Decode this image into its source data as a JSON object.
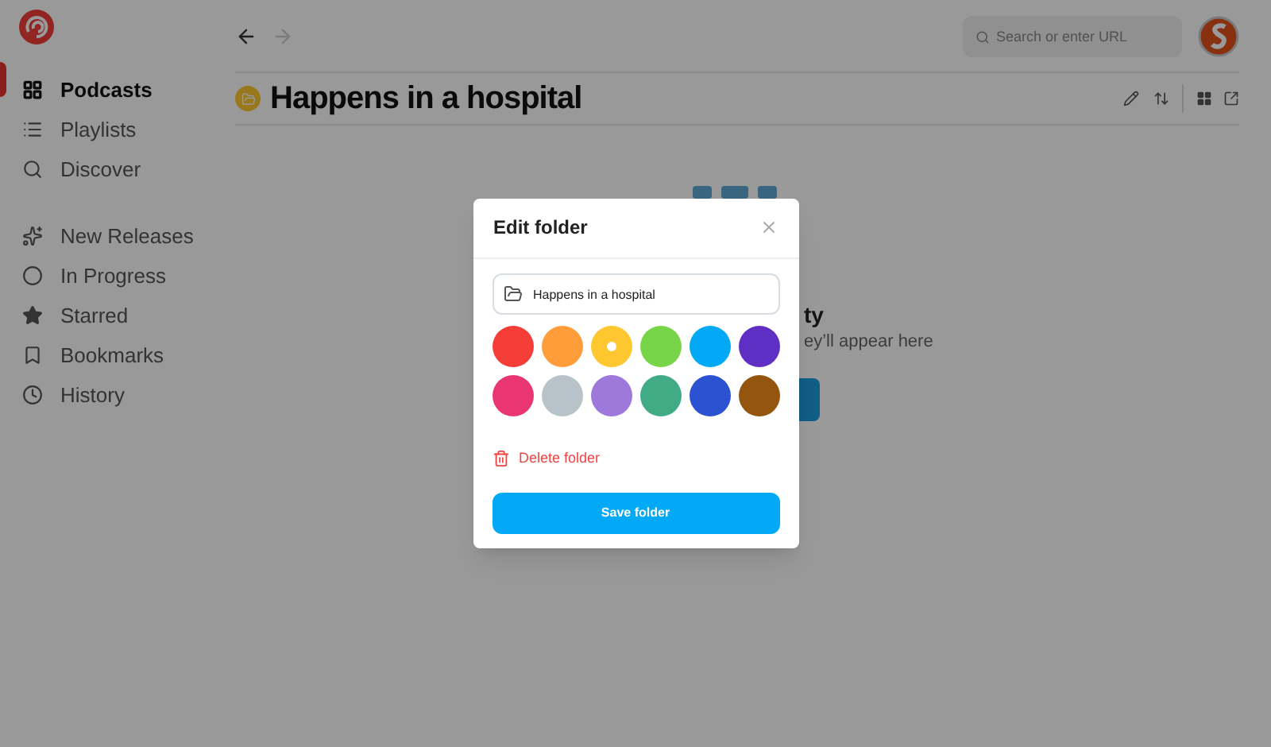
{
  "sidebar": {
    "items": [
      {
        "label": "Podcasts",
        "kind": "grid",
        "selected": true
      },
      {
        "label": "Playlists",
        "kind": "list",
        "selected": false
      },
      {
        "label": "Discover",
        "kind": "search",
        "selected": false
      }
    ],
    "library": [
      {
        "label": "New Releases",
        "kind": "sparkle",
        "selected": false
      },
      {
        "label": "In Progress",
        "kind": "circle",
        "selected": false
      },
      {
        "label": "Starred",
        "kind": "star",
        "selected": false
      },
      {
        "label": "Bookmarks",
        "kind": "bookmark",
        "selected": false
      },
      {
        "label": "History",
        "kind": "clock",
        "selected": false
      }
    ]
  },
  "search": {
    "placeholder": "Search or enter URL"
  },
  "page": {
    "title": "Happens in a hospital"
  },
  "empty_state": {
    "title_fragment": "ty",
    "text_fragment": "ey’ll appear here"
  },
  "dialog": {
    "title": "Edit folder",
    "name_value": "Happens in a hospital",
    "colors": [
      {
        "color": "#f43e37",
        "selected": false
      },
      {
        "color": "#ff9d3b",
        "selected": false
      },
      {
        "color": "#ffc72f",
        "selected": true
      },
      {
        "color": "#78d549",
        "selected": false
      },
      {
        "color": "#03a9f4",
        "selected": false
      },
      {
        "color": "#5f2fc4",
        "selected": false
      },
      {
        "color": "#e93672",
        "selected": false
      },
      {
        "color": "#b8c3c9",
        "selected": false
      },
      {
        "color": "#9e78da",
        "selected": false
      },
      {
        "color": "#41ab86",
        "selected": false
      },
      {
        "color": "#2b53d1",
        "selected": false
      },
      {
        "color": "#94560f",
        "selected": false
      }
    ],
    "delete_label": "Delete folder",
    "save_label": "Save folder"
  }
}
